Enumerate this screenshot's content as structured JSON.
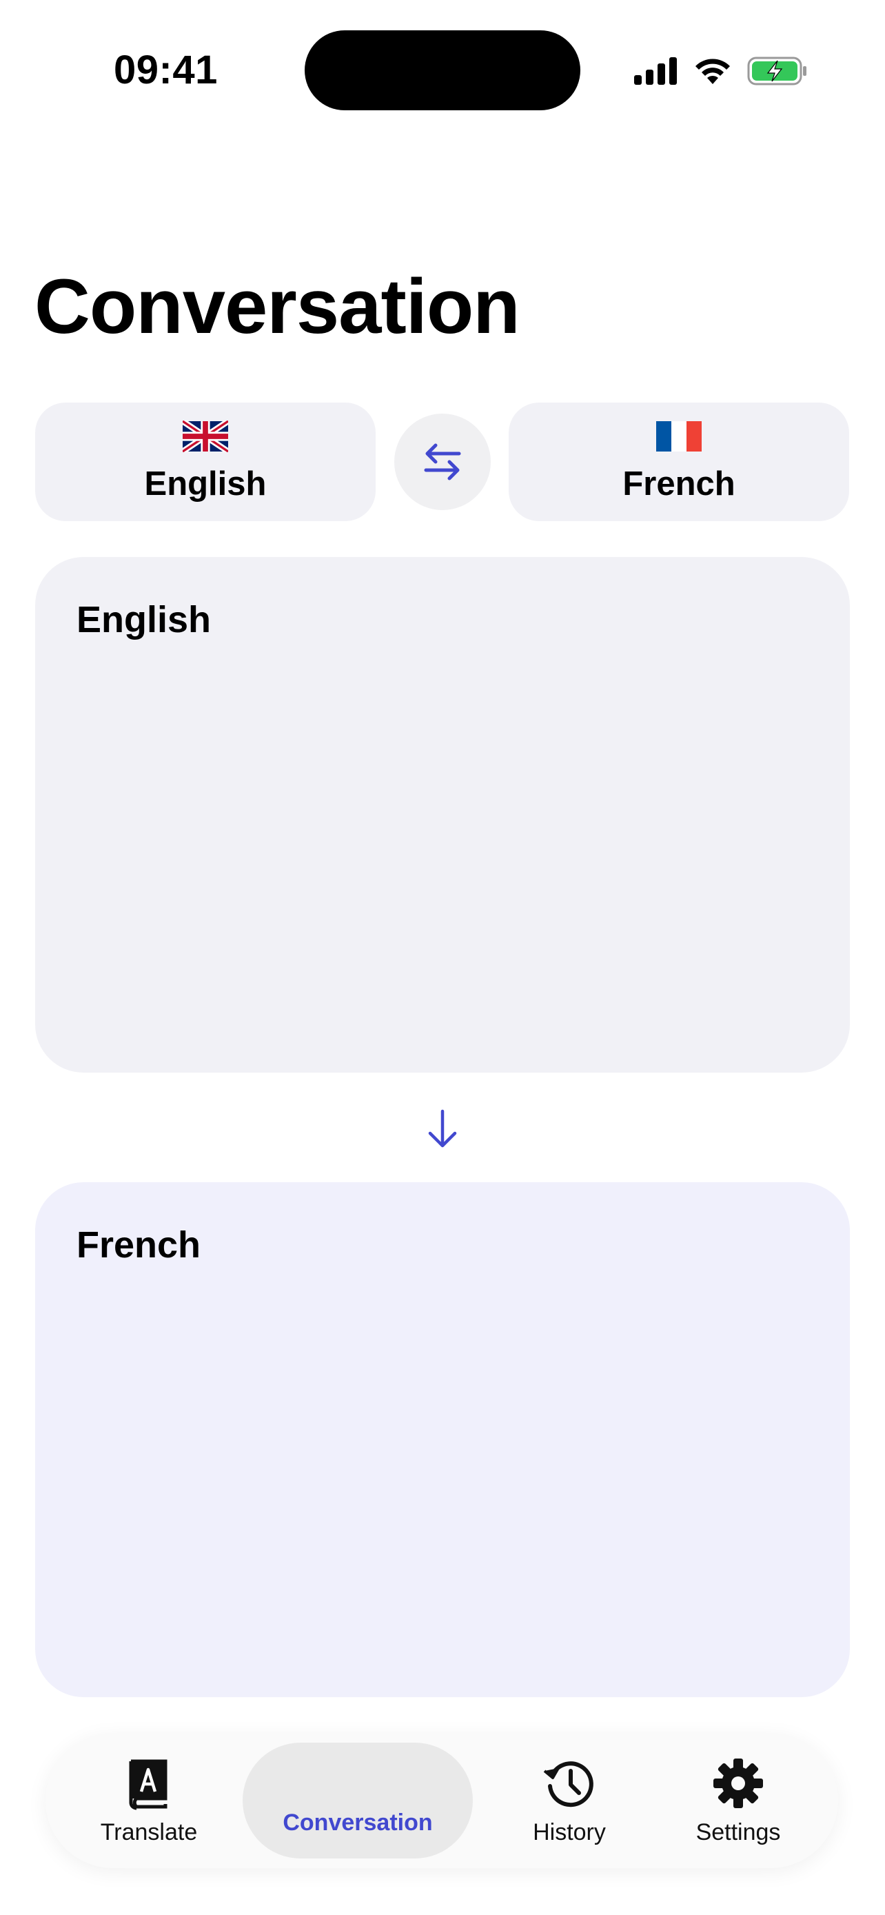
{
  "status_bar": {
    "time": "09:41",
    "icons": [
      "signal-bars-icon",
      "wifi-icon",
      "battery-charging-icon"
    ]
  },
  "page": {
    "title": "Conversation"
  },
  "language_selector": {
    "source": {
      "name": "English",
      "flag": "uk-flag-icon"
    },
    "target": {
      "name": "French",
      "flag": "france-flag-icon"
    },
    "swap_icon": "swap-arrows-icon"
  },
  "panels": {
    "source_label": "English",
    "target_label": "French",
    "direction_icon": "arrow-down-icon"
  },
  "tab_bar": {
    "tabs": [
      {
        "label": "Translate",
        "icon": "book-translate-icon",
        "active": false
      },
      {
        "label": "Conversation",
        "icon": "",
        "active": true
      },
      {
        "label": "History",
        "icon": "history-icon",
        "active": false
      },
      {
        "label": "Settings",
        "icon": "gear-icon",
        "active": false
      }
    ]
  },
  "colors": {
    "accent": "#4148cf",
    "panel_source": "#f1f1f6",
    "panel_target": "#f0f0fc",
    "battery": "#34c759"
  }
}
